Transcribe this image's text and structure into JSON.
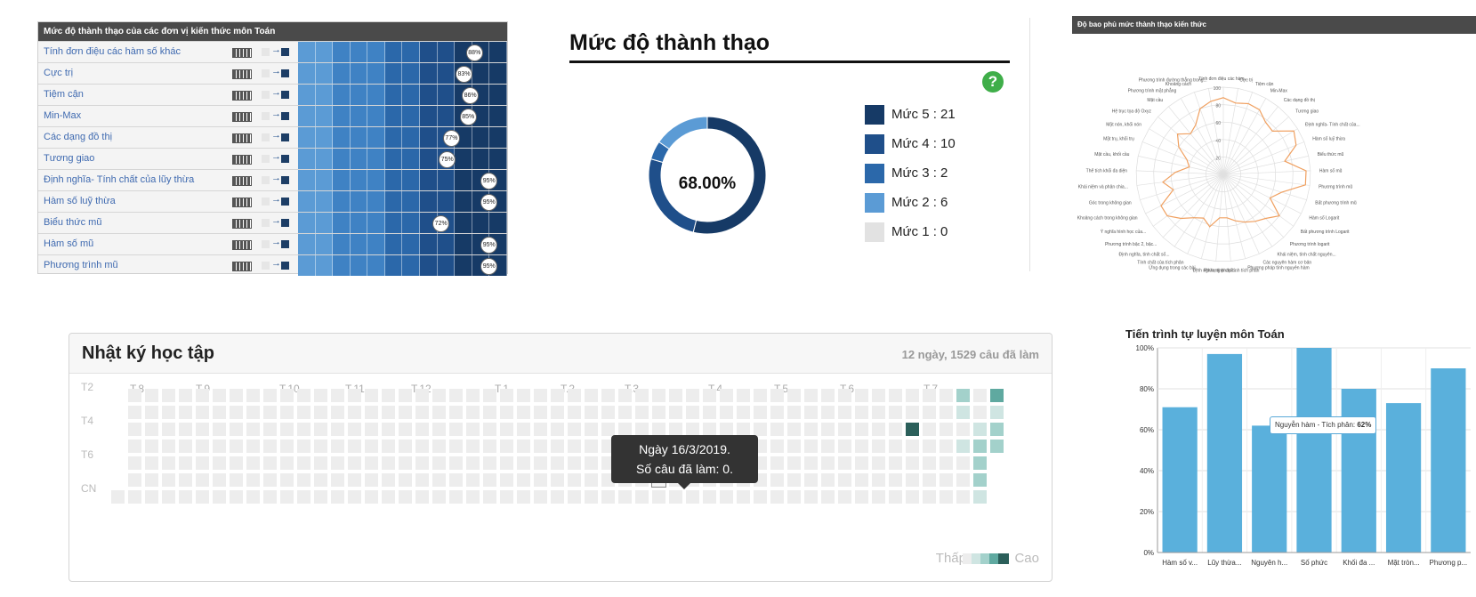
{
  "proficiency_table": {
    "title": "Mức độ thành thạo của các đơn vị kiến thức môn Toán",
    "rows": [
      {
        "label": "Tính đơn điệu các hàm số khác",
        "percent_label": "88%",
        "value": 88
      },
      {
        "label": "Cực trị",
        "percent_label": "83%",
        "value": 83
      },
      {
        "label": "Tiệm cận",
        "percent_label": "86%",
        "value": 86
      },
      {
        "label": "Min-Max",
        "percent_label": "85%",
        "value": 85
      },
      {
        "label": "Các dạng đồ thị",
        "percent_label": "77%",
        "value": 77
      },
      {
        "label": "Tương giao",
        "percent_label": "75%",
        "value": 75
      },
      {
        "label": "Định nghĩa- Tính chất của lũy thừa",
        "percent_label": "95%",
        "value": 95
      },
      {
        "label": "Hàm số luỹ thừa",
        "percent_label": "95%",
        "value": 95
      },
      {
        "label": "Biểu thức mũ",
        "percent_label": "72%",
        "value": 72
      },
      {
        "label": "Hàm số mũ",
        "percent_label": "95%",
        "value": 95
      },
      {
        "label": "Phương trình mũ",
        "percent_label": "95%",
        "value": 95
      }
    ],
    "colors": [
      "#5b9bd5",
      "#3f82c4",
      "#2b68aa",
      "#1f4f8a",
      "#163a66"
    ]
  },
  "mastery": {
    "title": "Mức độ thành thạo",
    "center_label": "68.00%",
    "help_icon": "question-circle-icon",
    "chart_data": {
      "type": "pie",
      "categories": [
        "Mức 5",
        "Mức 4",
        "Mức 3",
        "Mức 2",
        "Mức 1"
      ],
      "values": [
        21,
        10,
        2,
        6,
        0
      ],
      "colors": [
        "#163a66",
        "#1f4f8a",
        "#2b68aa",
        "#5b9bd5",
        "#e2e2e2"
      ]
    },
    "legend": [
      {
        "text": "Mức 5 : 21",
        "color": "#163a66"
      },
      {
        "text": "Mức 4 : 10",
        "color": "#1f4f8a"
      },
      {
        "text": "Mức 3 : 2",
        "color": "#2b68aa"
      },
      {
        "text": "Mức 2 : 6",
        "color": "#5b9bd5"
      },
      {
        "text": "Mức 1 : 0",
        "color": "#e2e2e2"
      }
    ]
  },
  "coverage": {
    "title": "Độ bao phủ mức thành thạo kiến thức",
    "chart_data": {
      "type": "radar",
      "ylim": [
        0,
        100
      ],
      "tick_labels": [
        "20",
        "40",
        "60",
        "80",
        "100"
      ],
      "categories": [
        "Tính đơn điệu các hàm...",
        "Cực trị",
        "Tiệm cận",
        "Min-Max",
        "Các dạng đồ thị",
        "Tương giao",
        "Định nghĩa- Tính chất của...",
        "Hàm số luỹ thừa",
        "Biểu thức mũ",
        "Hàm số mũ",
        "Phương trình mũ",
        "Bất phương trình mũ",
        "Hàm số Logarit",
        "Bất phương trình Logarit",
        "Phương trình logarit",
        "Khái niệm, tính chất nguyên...",
        "Các nguyên hàm cơ bản",
        "Phương pháp tính nguyên hàm",
        "Phương pháp tính tích phân",
        "Định nghĩa, tính chất...",
        "Ứng dụng trong các bài...",
        "Tính chất của tích phân",
        "Định nghĩa, tính chất số...",
        "Phương trình bậc 2, bậc...",
        "Ý nghĩa hình học của...",
        "Khoảng cách trong không gian",
        "Góc trong không gian",
        "Khái niệm và phân chia...",
        "Thể tích khối đa diện",
        "Mặt cầu, khối cầu",
        "Mặt trụ, khối trụ",
        "Mặt nón, khối nón",
        "Hệ trục tọa độ Oxyz",
        "Mặt cầu",
        "Phương trình mặt phẳng",
        "Khoảng cách",
        "Phương trình đường thẳng trong..."
      ],
      "values": [
        88,
        83,
        86,
        85,
        77,
        75,
        95,
        90,
        72,
        95,
        95,
        70,
        60,
        80,
        70,
        65,
        60,
        55,
        50,
        50,
        62,
        55,
        60,
        70,
        80,
        80,
        60,
        70,
        55,
        40,
        45,
        60,
        70,
        60,
        65,
        80,
        85
      ],
      "line_color": "#f0a060"
    }
  },
  "journal": {
    "title": "Nhật ký học tập",
    "summary": "12 ngày, 1529 câu đã làm",
    "months": [
      "T.8",
      "T.9",
      "T.10",
      "T.11",
      "T.12",
      "T.1",
      "T.2",
      "T.3",
      "T.4",
      "T.5",
      "T.6",
      "T.7"
    ],
    "day_labels": [
      "T2",
      "T4",
      "T6",
      "CN"
    ],
    "tooltip_line1": "Ngày 16/3/2019.",
    "tooltip_line2": "Số câu đã làm: 0.",
    "legend_low": "Thấp",
    "legend_high": "Cao",
    "colors": {
      "empty": "#ededed",
      "l1": "#cfe5e2",
      "l2": "#a3d1cb",
      "l3": "#5fa9a0",
      "l4": "#2b5f5a"
    }
  },
  "self_study": {
    "title": "Tiến trình tự luyện môn Toán",
    "tooltip_label": "Nguyễn hàm - Tích phân:",
    "tooltip_value": "62%",
    "chart_data": {
      "type": "bar",
      "categories": [
        "Hàm số v...",
        "Lũy thừa...",
        "Nguyên h...",
        "Số phức",
        "Khối đa ...",
        "Mặt tròn...",
        "Phương p..."
      ],
      "values": [
        71,
        97,
        62,
        100,
        80,
        73,
        90
      ],
      "ylim": [
        0,
        100
      ],
      "tick_labels": [
        "0%",
        "20%",
        "40%",
        "60%",
        "80%",
        "100%"
      ],
      "bar_color": "#5ab0dc"
    }
  }
}
